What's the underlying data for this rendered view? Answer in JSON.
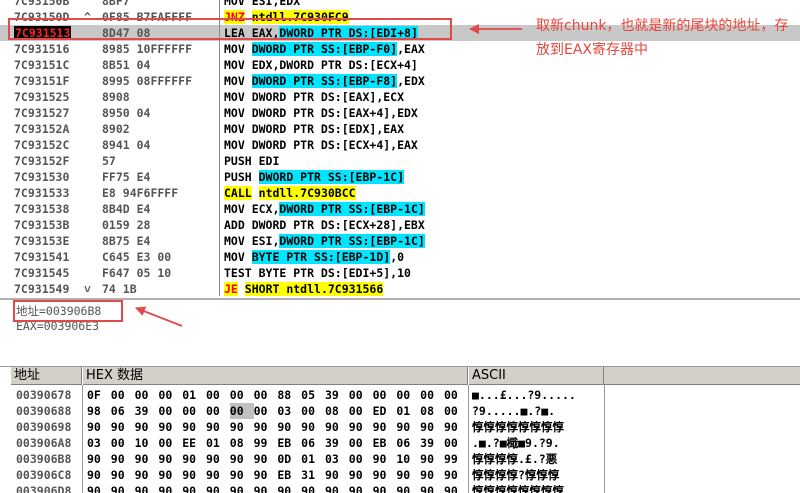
{
  "cpu": {
    "rows": [
      {
        "addr": "7C93150B",
        "mark": "",
        "hex": "8BF7",
        "cmd": [
          {
            "t": "MOV ESI,EDX"
          }
        ]
      },
      {
        "addr": "7C93150D",
        "mark": "^",
        "hex": "0F85 B7FAFFFF",
        "cmd": [
          {
            "t": "JNZ",
            "c": "y-red"
          },
          {
            "t": " "
          },
          {
            "t": "ntdll.7C930FC9",
            "c": "y"
          }
        ]
      },
      {
        "addr": "7C931513",
        "mark": "",
        "hex": "8D47 08",
        "selected": true,
        "cmd": [
          {
            "t": "LEA EAX,"
          },
          {
            "t": "DWORD PTR DS:[EDI+8]",
            "c": "c"
          }
        ]
      },
      {
        "addr": "7C931516",
        "mark": "",
        "hex": "8985 10FFFFFF",
        "cmd": [
          {
            "t": "MOV "
          },
          {
            "t": "DWORD PTR SS:[EBP-F0]",
            "c": "c"
          },
          {
            "t": ",EAX"
          }
        ]
      },
      {
        "addr": "7C93151C",
        "mark": "",
        "hex": "8B51 04",
        "cmd": [
          {
            "t": "MOV EDX,DWORD PTR DS:[ECX+4]"
          }
        ]
      },
      {
        "addr": "7C93151F",
        "mark": "",
        "hex": "8995 08FFFFFF",
        "cmd": [
          {
            "t": "MOV "
          },
          {
            "t": "DWORD PTR SS:[EBP-F8]",
            "c": "c"
          },
          {
            "t": ",EDX"
          }
        ]
      },
      {
        "addr": "7C931525",
        "mark": "",
        "hex": "8908",
        "cmd": [
          {
            "t": "MOV DWORD PTR DS:[EAX],ECX"
          }
        ]
      },
      {
        "addr": "7C931527",
        "mark": "",
        "hex": "8950 04",
        "cmd": [
          {
            "t": "MOV DWORD PTR DS:[EAX+4],EDX"
          }
        ]
      },
      {
        "addr": "7C93152A",
        "mark": "",
        "hex": "8902",
        "cmd": [
          {
            "t": "MOV DWORD PTR DS:[EDX],EAX"
          }
        ]
      },
      {
        "addr": "7C93152C",
        "mark": "",
        "hex": "8941 04",
        "cmd": [
          {
            "t": "MOV DWORD PTR DS:[ECX+4],EAX"
          }
        ]
      },
      {
        "addr": "7C93152F",
        "mark": "",
        "hex": "57",
        "cmd": [
          {
            "t": "PUSH EDI"
          }
        ]
      },
      {
        "addr": "7C931530",
        "mark": "",
        "hex": "FF75 E4",
        "cmd": [
          {
            "t": "PUSH "
          },
          {
            "t": "DWORD PTR SS:[EBP-1C]",
            "c": "c"
          }
        ]
      },
      {
        "addr": "7C931533",
        "mark": "",
        "hex": "E8 94F6FFFF",
        "cmd": [
          {
            "t": "CALL",
            "c": "y"
          },
          {
            "t": " "
          },
          {
            "t": "ntdll.7C930BCC",
            "c": "y"
          }
        ]
      },
      {
        "addr": "7C931538",
        "mark": "",
        "hex": "8B4D E4",
        "cmd": [
          {
            "t": "MOV ECX,"
          },
          {
            "t": "DWORD PTR SS:[EBP-1C]",
            "c": "c"
          }
        ]
      },
      {
        "addr": "7C93153B",
        "mark": "",
        "hex": "0159 28",
        "cmd": [
          {
            "t": "ADD DWORD PTR DS:[ECX+28],EBX"
          }
        ]
      },
      {
        "addr": "7C93153E",
        "mark": "",
        "hex": "8B75 E4",
        "cmd": [
          {
            "t": "MOV ESI,"
          },
          {
            "t": "DWORD PTR SS:[EBP-1C]",
            "c": "c"
          }
        ]
      },
      {
        "addr": "7C931541",
        "mark": "",
        "hex": "C645 E3 00",
        "cmd": [
          {
            "t": "MOV "
          },
          {
            "t": "BYTE PTR SS:[EBP-1D]",
            "c": "c"
          },
          {
            "t": ",0"
          }
        ]
      },
      {
        "addr": "7C931545",
        "mark": "",
        "hex": "F647 05 10",
        "cmd": [
          {
            "t": "TEST BYTE PTR DS:[EDI+5],10"
          }
        ]
      },
      {
        "addr": "7C931549",
        "mark": "˅",
        "hex": "74 1B",
        "cmd": [
          {
            "t": "JE",
            "c": "y-red"
          },
          {
            "t": " "
          },
          {
            "t": "SHORT ntdll.7C931566",
            "c": "y"
          }
        ]
      }
    ]
  },
  "annotation": {
    "text": "取新chunk，也就是新的尾块的地址，存放到EAX寄存器中"
  },
  "info": {
    "line1": "地址=003906B8",
    "line2": "EAX=003906E3"
  },
  "dump": {
    "headers": {
      "address": "地址",
      "hex": "HEX 数据",
      "ascii": "ASCII"
    },
    "rows": [
      {
        "addr": "00390678",
        "bytes": [
          "0F",
          "00",
          "00",
          "00",
          "01",
          "00",
          "00",
          "00",
          "88",
          "05",
          "39",
          "00",
          "00",
          "00",
          "00",
          "00"
        ],
        "ascii": "■...£...?9....."
      },
      {
        "addr": "00390688",
        "bytes": [
          "98",
          "06",
          "39",
          "00",
          "00",
          "00",
          "00",
          "00",
          "03",
          "00",
          "08",
          "00",
          "ED",
          "01",
          "08",
          "00"
        ],
        "ascii": "?9.....■.?■."
      },
      {
        "addr": "00390698",
        "bytes": [
          "90",
          "90",
          "90",
          "90",
          "90",
          "90",
          "90",
          "90",
          "90",
          "90",
          "90",
          "90",
          "90",
          "90",
          "90",
          "90"
        ],
        "ascii": "惇惇惇惇惇惇惇惇"
      },
      {
        "addr": "003906A8",
        "bytes": [
          "03",
          "00",
          "10",
          "00",
          "EE",
          "01",
          "08",
          "99",
          "EB",
          "06",
          "39",
          "00",
          "EB",
          "06",
          "39",
          "00"
        ],
        "ascii": ".■.?■檝■9.?9."
      },
      {
        "addr": "003906B8",
        "bytes": [
          "90",
          "90",
          "90",
          "90",
          "90",
          "90",
          "90",
          "90",
          "0D",
          "01",
          "03",
          "00",
          "90",
          "10",
          "90",
          "99"
        ],
        "ascii": "惇惇惇惇.£.?悪"
      },
      {
        "addr": "003906C8",
        "bytes": [
          "90",
          "90",
          "90",
          "90",
          "90",
          "90",
          "90",
          "90",
          "EB",
          "31",
          "90",
          "90",
          "90",
          "90",
          "90",
          "90"
        ],
        "ascii": "惇惇惇惇?惇惇惇"
      },
      {
        "addr": "003906D8",
        "bytes": [
          "90",
          "90",
          "90",
          "90",
          "90",
          "90",
          "90",
          "90",
          "90",
          "90",
          "90",
          "90",
          "90",
          "90",
          "90",
          "90"
        ],
        "ascii": "惇惇惇惇惇惇惇惇"
      }
    ]
  },
  "colors": {
    "cyan": "#00e5ff",
    "yellow": "#ffff00",
    "annot_red": "#e04a4a"
  }
}
